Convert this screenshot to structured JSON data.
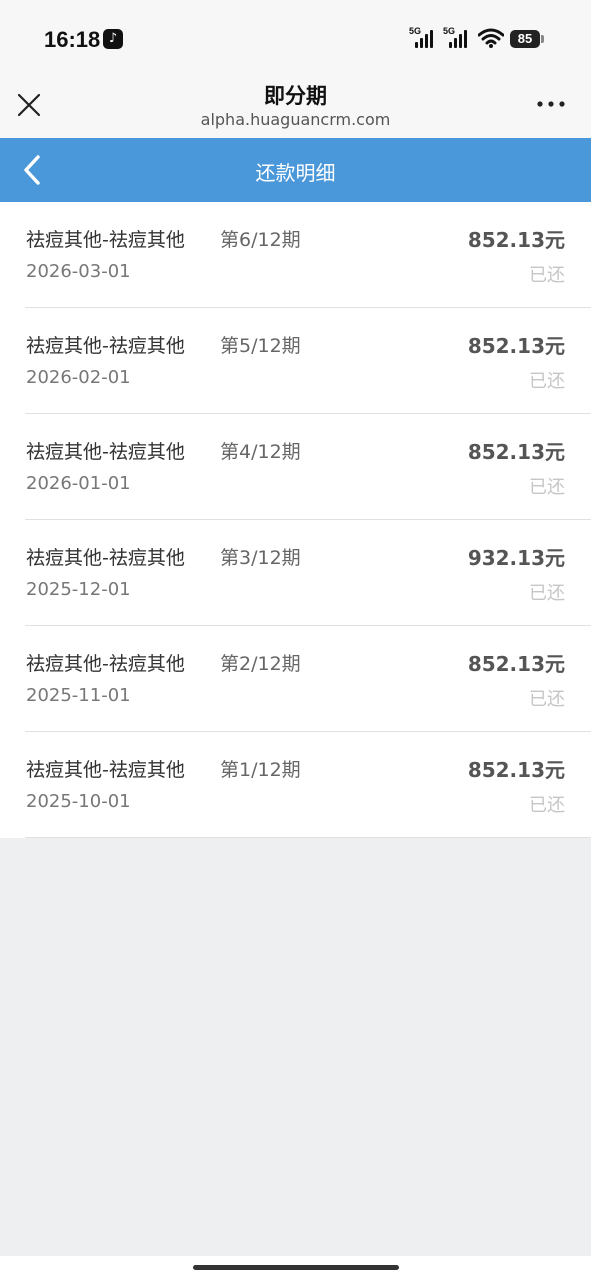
{
  "status_bar": {
    "time": "16:18",
    "signal_1_label": "5G",
    "signal_2_label": "5G",
    "battery": "85"
  },
  "browser": {
    "title": "即分期",
    "url": "alpha.huaguancrm.com"
  },
  "nav": {
    "title": "还款明细"
  },
  "repayments": [
    {
      "name": "祛痘其他-祛痘其他",
      "period": "第6/12期",
      "date": "2026-03-01",
      "amount": "852.13元",
      "status": "已还"
    },
    {
      "name": "祛痘其他-祛痘其他",
      "period": "第5/12期",
      "date": "2026-02-01",
      "amount": "852.13元",
      "status": "已还"
    },
    {
      "name": "祛痘其他-祛痘其他",
      "period": "第4/12期",
      "date": "2026-01-01",
      "amount": "852.13元",
      "status": "已还"
    },
    {
      "name": "祛痘其他-祛痘其他",
      "period": "第3/12期",
      "date": "2025-12-01",
      "amount": "932.13元",
      "status": "已还"
    },
    {
      "name": "祛痘其他-祛痘其他",
      "period": "第2/12期",
      "date": "2025-11-01",
      "amount": "852.13元",
      "status": "已还"
    },
    {
      "name": "祛痘其他-祛痘其他",
      "period": "第1/12期",
      "date": "2025-10-01",
      "amount": "852.13元",
      "status": "已还"
    }
  ],
  "colors": {
    "nav_background": "#4a97d9",
    "page_background": "#eeeff1",
    "status_paid": "#c6c6c6"
  }
}
